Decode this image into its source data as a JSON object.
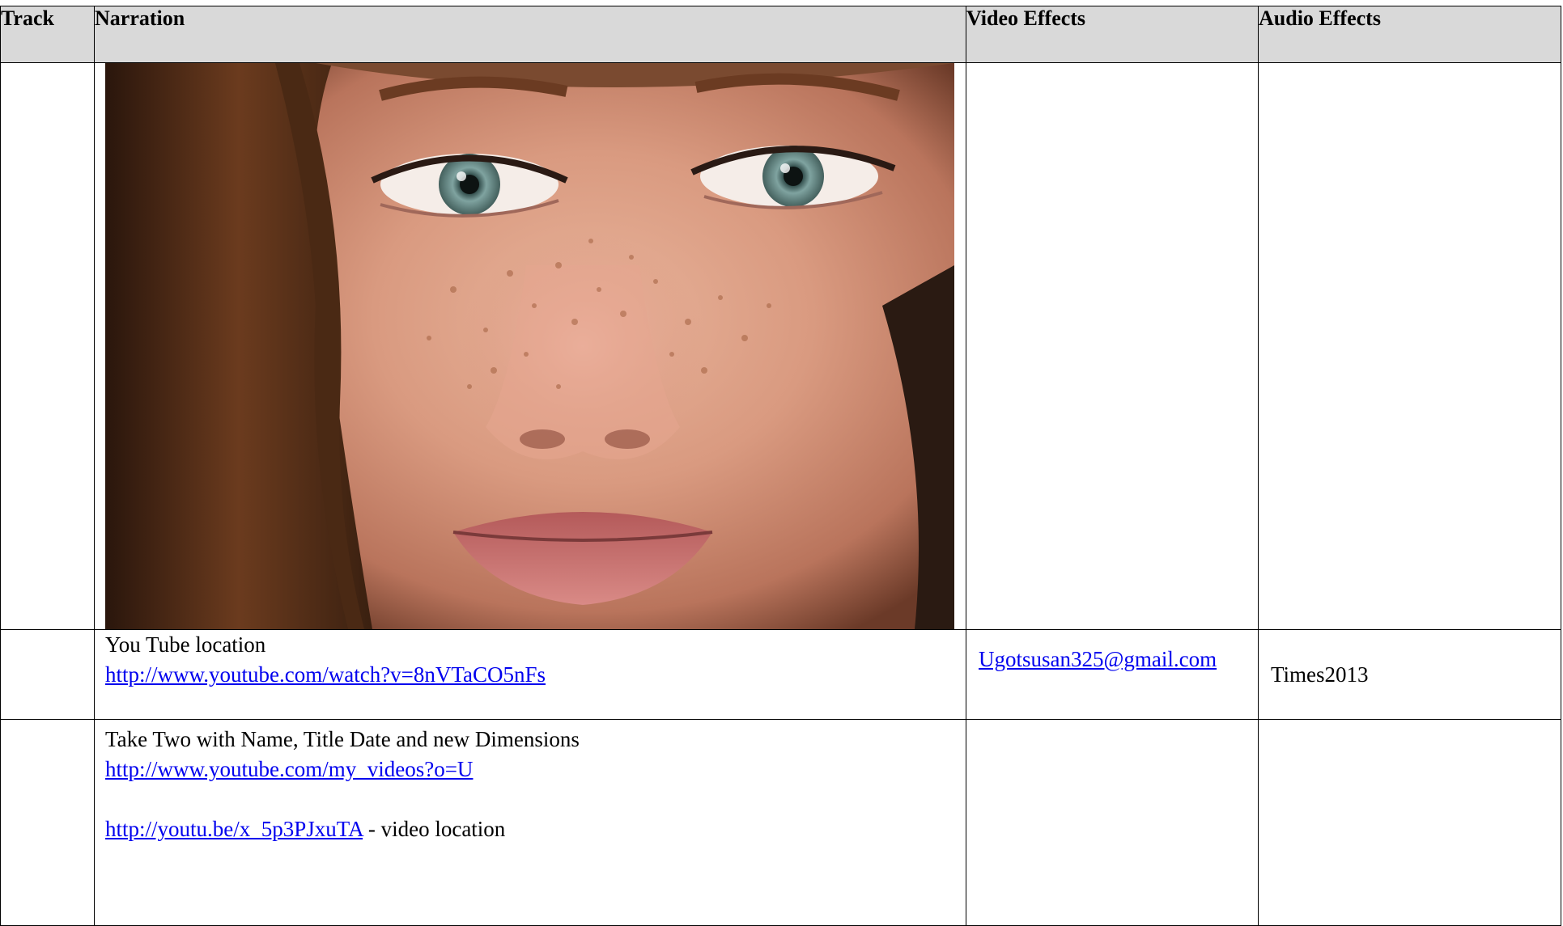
{
  "table": {
    "headers": {
      "track": "Track",
      "narration": "Narration",
      "video_effects": "Video Effects",
      "audio_effects": "Audio Effects"
    },
    "rows": [
      {
        "track": "",
        "narration_image": "close-up-freckled-face-photo",
        "video_effects": "",
        "audio_effects": ""
      },
      {
        "track": "",
        "narration_text": "You Tube location",
        "narration_link": "http://www.youtube.com/watch?v=8nVTaCO5nFs",
        "video_effects_link": "Ugotsusan325@gmail.com",
        "audio_effects": "Times2013"
      },
      {
        "track": "",
        "narration_text": "Take Two with Name, Title Date and new Dimensions",
        "narration_link": "http://www.youtube.com/my_videos?o=U",
        "narration_link_2": "http://youtu.be/x_5p3PJxuTA",
        "narration_link_2_suffix": " - video location",
        "video_effects": "",
        "audio_effects": ""
      }
    ]
  },
  "colors": {
    "header_bg": "#d9d9d9",
    "link": "#0000ee",
    "border": "#000000"
  }
}
